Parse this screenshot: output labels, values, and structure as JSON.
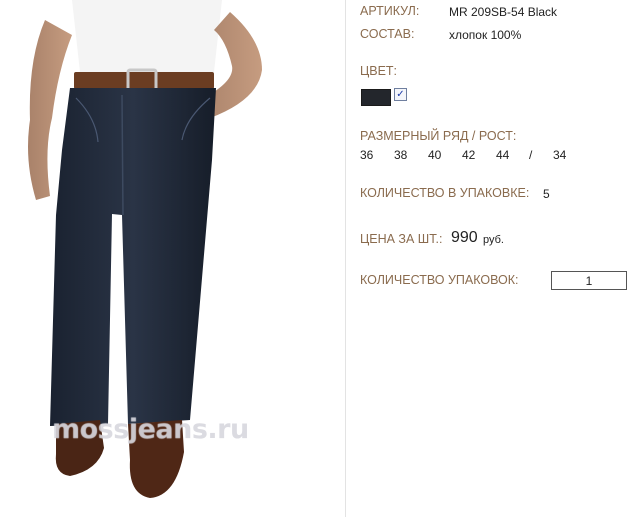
{
  "product": {
    "watermark": "mossjeans.ru",
    "article_label": "АРТИКУЛ:",
    "article_value": "MR 209SB-54 Black",
    "composition_label": "СОСТАВ:",
    "composition_value": "хлопок 100%",
    "color_label": "ЦВЕТ:",
    "color_swatch": "#23262c",
    "color_checked": "✓",
    "size_label": "РАЗМЕРНЫЙ РЯД / РОСТ:",
    "sizes": [
      "36",
      "38",
      "40",
      "42",
      "44",
      "/",
      "34"
    ],
    "pack_qty_label": "КОЛИЧЕСТВО В УПАКОВКЕ:",
    "pack_qty_value": "5",
    "price_label": "ЦЕНА ЗА ШТ.:",
    "price_value": "990",
    "price_currency": "руб.",
    "packs_label": "КОЛИЧЕСТВО УПАКОВОК:",
    "packs_value": "1"
  }
}
